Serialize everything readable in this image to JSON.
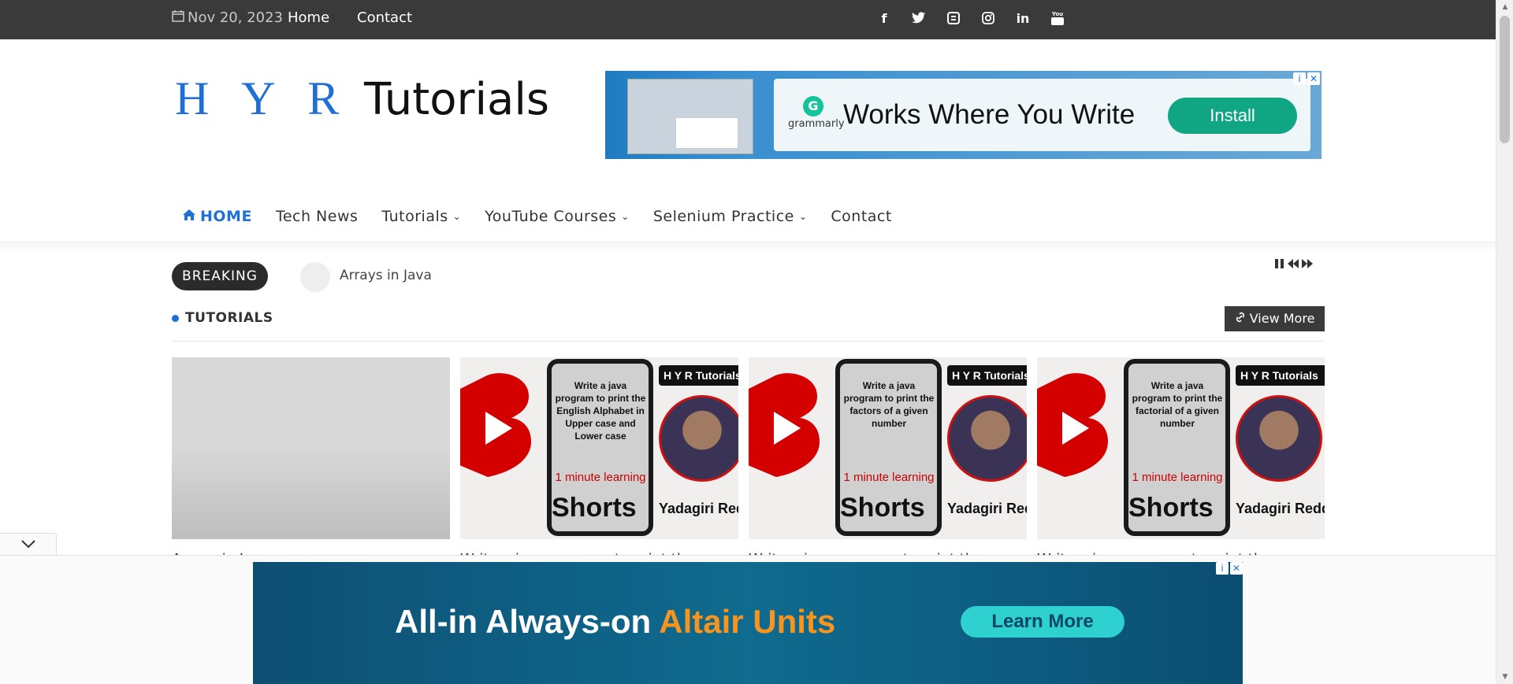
{
  "topbar": {
    "date": "Nov 20, 2023",
    "links": [
      "Home",
      "Contact"
    ],
    "social_icons": [
      "facebook-icon",
      "twitter-icon",
      "blogger-icon",
      "instagram-icon",
      "linkedin-icon",
      "youtube-icon"
    ]
  },
  "logo": {
    "part1": "H Y R",
    "part2": " Tutorials"
  },
  "ad_top": {
    "brand": "grammarly",
    "headline": "Works Where You Write",
    "button": "Install"
  },
  "nav": {
    "items": [
      {
        "label": "HOME",
        "icon": "home-icon",
        "active": true
      },
      {
        "label": "Tech News"
      },
      {
        "label": "Tutorials",
        "dropdown": true
      },
      {
        "label": "YouTube Courses",
        "dropdown": true
      },
      {
        "label": "Selenium Practice",
        "dropdown": true
      },
      {
        "label": "Contact"
      }
    ]
  },
  "breaking": {
    "label": "BREAKING",
    "headline": "Arrays in Java"
  },
  "section": {
    "title": "TUTORIALS",
    "view_more": "View More"
  },
  "cards": [
    {
      "title": "Arrays in Java"
    },
    {
      "thumb_text": "Write a java program to print the English Alphabet in Upper case and Lower case",
      "badge": "1 minute learning",
      "shorts": "Shorts",
      "brand": "H Y R Tutorials",
      "author": "Yadagiri Reddy",
      "title": "Write a java program to print the"
    },
    {
      "thumb_text": "Write a java program to print the factors of a given number",
      "badge": "1 minute learning",
      "shorts": "Shorts",
      "brand": "H Y R Tutorials",
      "author": "Yadagiri Reddy",
      "title": "Write a java program to print the"
    },
    {
      "thumb_text": "Write a java program to print the factorial of a given number",
      "badge": "1 minute learning",
      "shorts": "Shorts",
      "brand": "H Y R Tutorials",
      "author": "Yadagiri Reddy",
      "title": "Write a java program to print the"
    }
  ],
  "ad_bottom": {
    "text_main": "All-in Always-on ",
    "text_accent": "Altair Units",
    "button": "Learn More"
  },
  "colors": {
    "accent": "#1e6fd6",
    "topbar": "#3a3a3a",
    "youtube_red": "#d40000"
  }
}
